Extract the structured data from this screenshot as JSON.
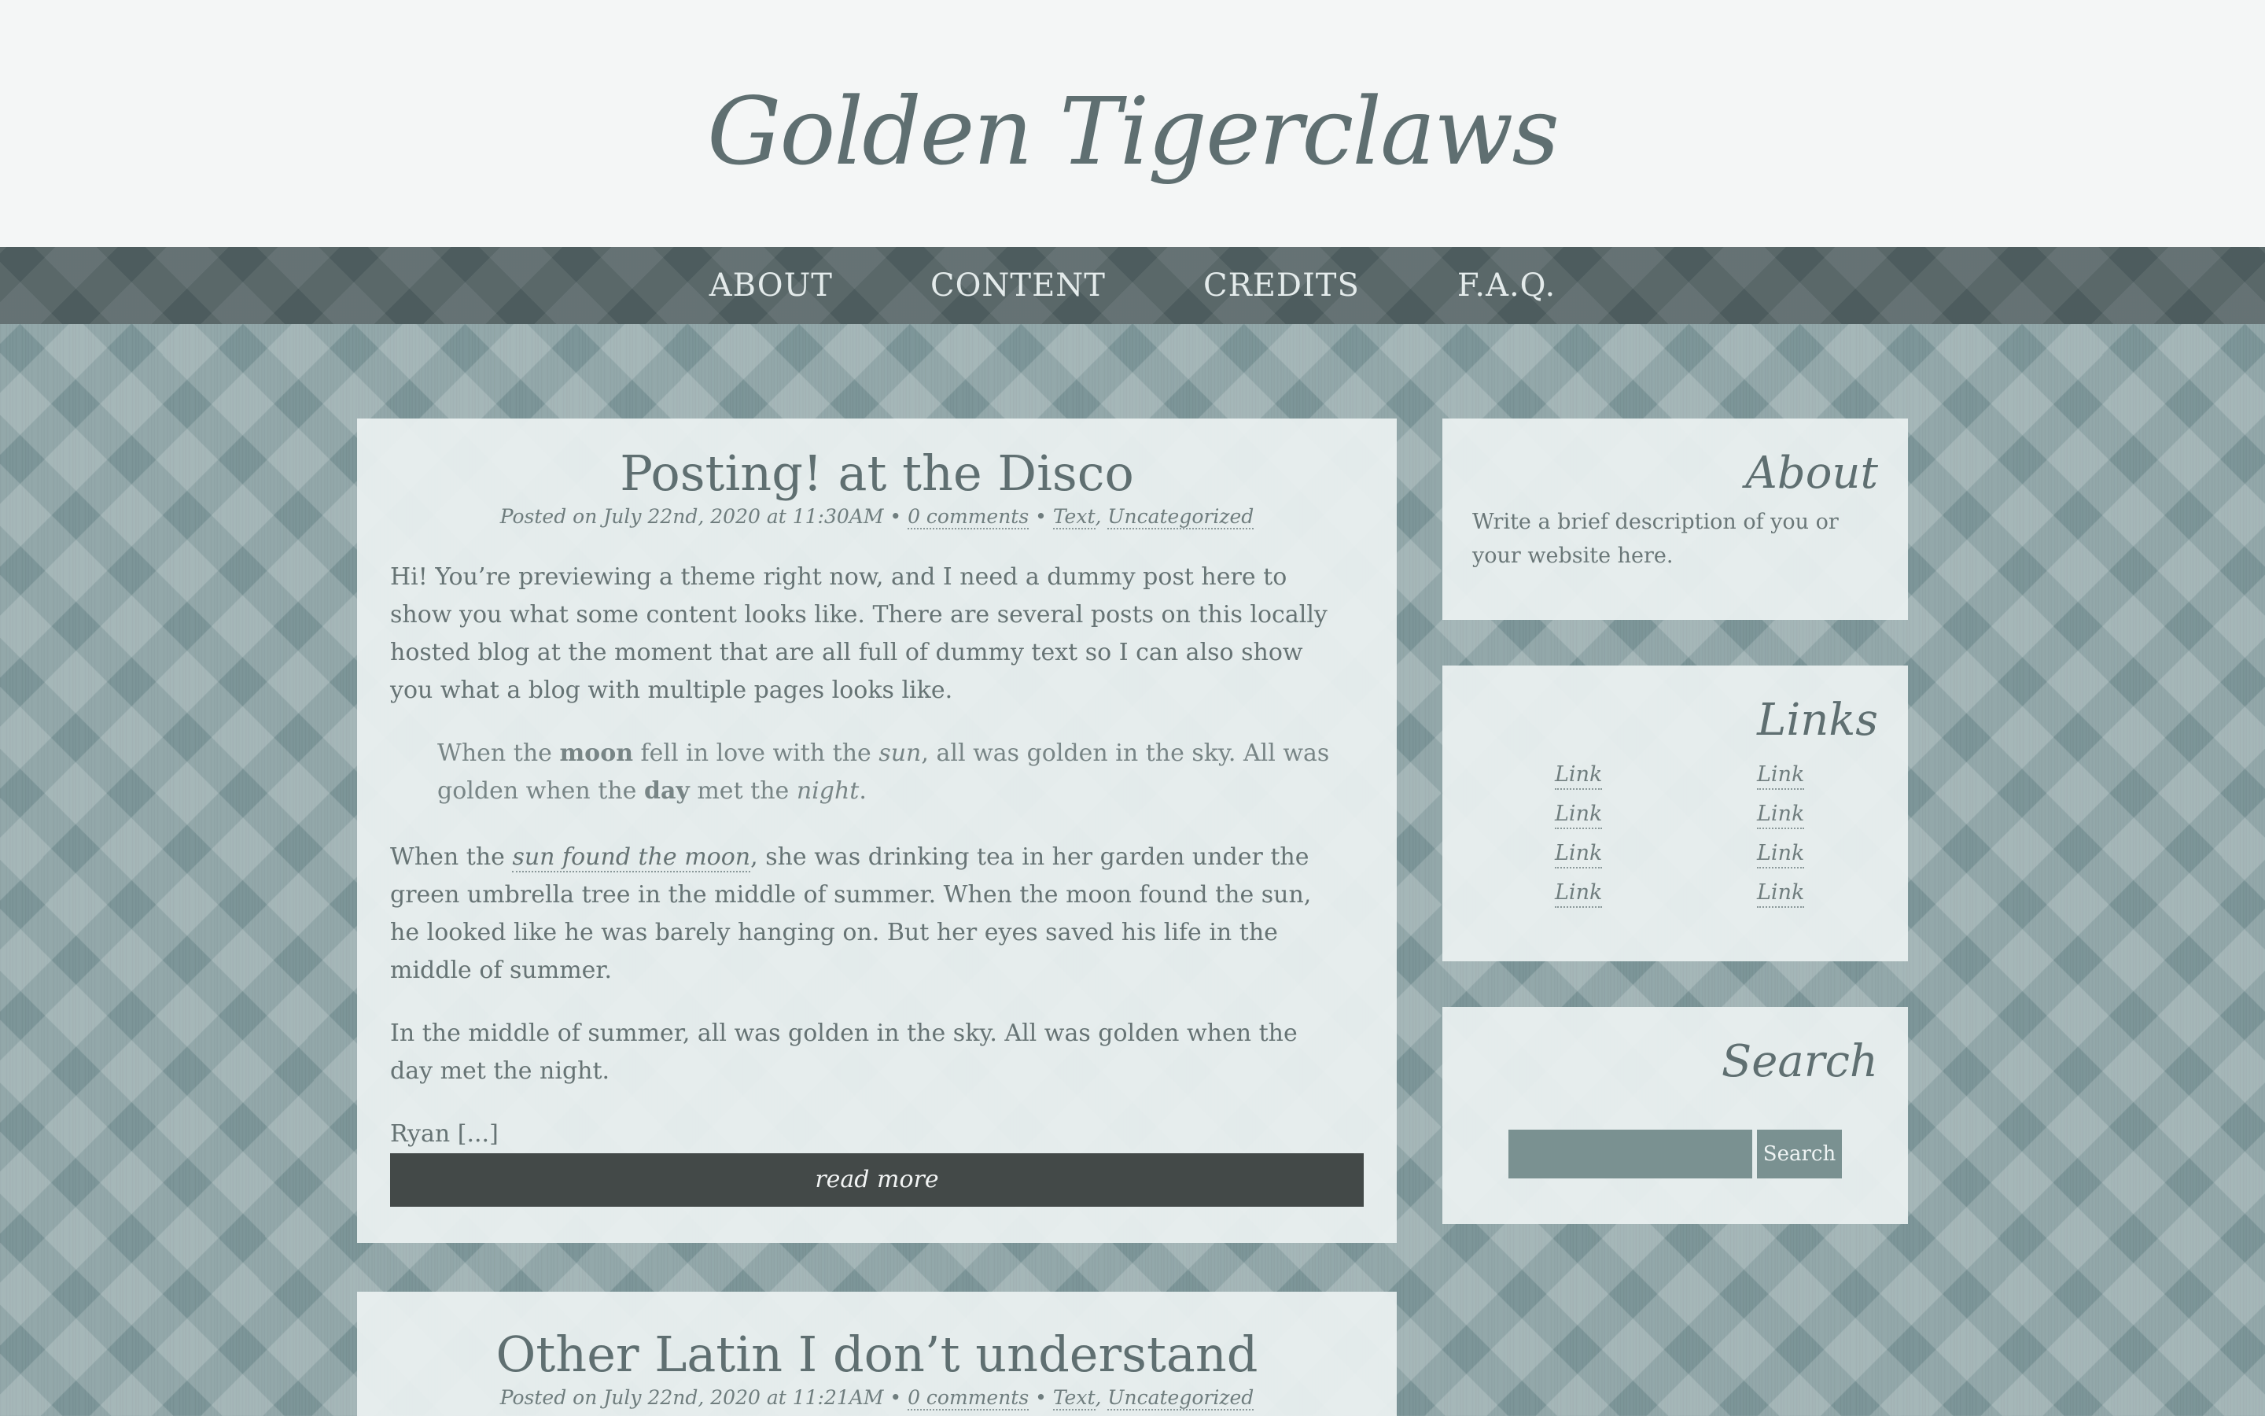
{
  "site": {
    "title": "Golden Tigerclaws"
  },
  "nav": {
    "items": [
      {
        "label": "ABOUT"
      },
      {
        "label": "CONTENT"
      },
      {
        "label": "CREDITS"
      },
      {
        "label": "F.A.Q."
      }
    ]
  },
  "posts": [
    {
      "title": "Posting! at the Disco",
      "meta_prefix": "Posted on July 22nd, 2020 at 11:30AM • ",
      "comments": "0 comments",
      "sep": " • ",
      "tag1": "Text",
      "comma": ", ",
      "tag2": "Uncategorized",
      "p1": "Hi! You’re previewing a theme right now, and I need a dummy post here to show you what some content looks like. There are several posts on this locally hosted blog at the moment that are all full of dummy text so I can also show you what a blog with multiple pages looks like.",
      "quote": {
        "a": "When the ",
        "b": "moon",
        "c": " fell in love with the ",
        "d": "sun",
        "e": ", all was golden in the sky. All was golden when the ",
        "f": "day",
        "g": " met the ",
        "h": "night",
        "i": "."
      },
      "p2": {
        "a": "When the ",
        "link": "sun found the moon",
        "b": ", she was drinking tea in her garden under the green umbrella tree in the middle of summer. When the moon found the sun, he looked like he was barely hanging on. But her eyes saved his life in the middle of summer."
      },
      "p3": "In the middle of summer, all was golden in the sky. All was golden when the day met the night.",
      "p4": "Ryan [...]",
      "read_more": "read more"
    },
    {
      "title": "Other Latin I don’t understand",
      "meta_prefix": "Posted on July 22nd, 2020 at 11:21AM • ",
      "comments": "0 comments",
      "sep": " • ",
      "tag1": "Text",
      "comma": ", ",
      "tag2": "Uncategorized"
    }
  ],
  "sidebar": {
    "about": {
      "title": "About",
      "text": "Write a brief description of you or your website here."
    },
    "links": {
      "title": "Links",
      "items": [
        "Link",
        "Link",
        "Link",
        "Link",
        "Link",
        "Link",
        "Link",
        "Link"
      ]
    },
    "search": {
      "title": "Search",
      "input_value": "",
      "button_label": "Search"
    }
  },
  "colors": {
    "background": "#7d9699",
    "header": "#f4f6f6",
    "nav": "#4d5c5e",
    "card": "#eaf0f0",
    "read_more": "#434948",
    "search_controls": "#7a9191",
    "text": "#5f6f71"
  }
}
